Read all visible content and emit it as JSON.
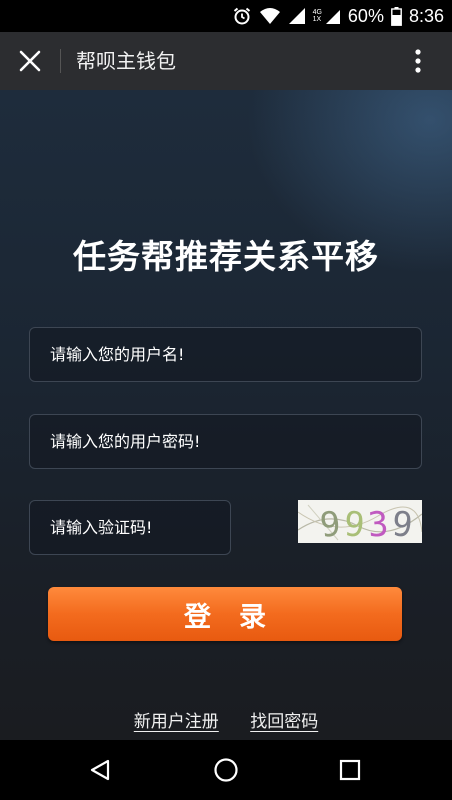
{
  "status_bar": {
    "battery": "60%",
    "time": "8:36",
    "network_top": "4G",
    "network_bottom": "1X"
  },
  "header": {
    "title": "帮呗主钱包"
  },
  "main": {
    "title": "任务帮推荐关系平移",
    "username_placeholder": "请输入您的用户名!",
    "password_placeholder": "请输入您的用户密码!",
    "captcha_placeholder": "请输入验证码!",
    "captcha_code": "9939",
    "login_label": "登录"
  },
  "links": {
    "register": "新用户注册",
    "recover": "找回密码"
  },
  "colors": {
    "accent": "#f36b1e",
    "header_bg": "#2c2d30"
  },
  "icons": {
    "close": "close-icon",
    "more": "more-vert-icon",
    "back": "back-triangle-icon",
    "home": "home-circle-icon",
    "recents": "recents-square-icon"
  }
}
